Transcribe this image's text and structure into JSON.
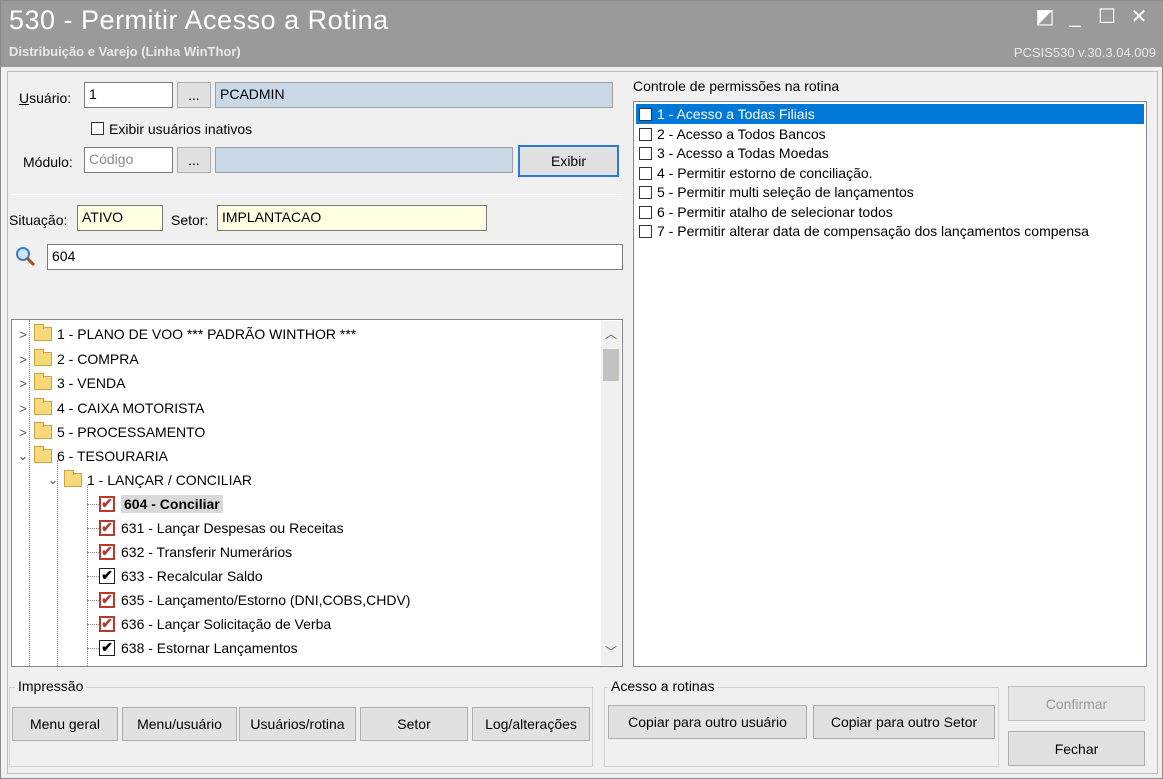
{
  "window": {
    "title": "530 - Permitir Acesso a Rotina",
    "subtitle": "Distribuição e Varejo (Linha WinThor)",
    "version": "PCSIS530  v.30.3.04.009",
    "controls": {
      "restore": "◩",
      "minimize": "_",
      "maximize": "☐",
      "close": "✕"
    }
  },
  "filters": {
    "usuario_label": "Usuário:",
    "usuario_code": "1",
    "usuario_browse": "...",
    "usuario_name": "PCADMIN",
    "inativos_label": "Exibir usuários inativos",
    "modulo_label": "Módulo:",
    "modulo_placeholder": "Código",
    "modulo_browse": "...",
    "exibir_button": "Exibir",
    "situacao_label": "Situação:",
    "situacao_value": "ATIVO",
    "setor_label": "Setor:",
    "setor_value": "IMPLANTACAO",
    "search_value": "604"
  },
  "tree": {
    "modules": [
      {
        "label": "1 - PLANO DE VOO   ***   PADRÃO WINTHOR  ***",
        "expanded": false
      },
      {
        "label": "2 - COMPRA",
        "expanded": false
      },
      {
        "label": "3 - VENDA",
        "expanded": false
      },
      {
        "label": "4 - CAIXA MOTORISTA",
        "expanded": false
      },
      {
        "label": "5 - PROCESSAMENTO",
        "expanded": false
      },
      {
        "label": "6 - TESOURARIA",
        "expanded": true
      }
    ],
    "subgroup": "1 - LANÇAR / CONCILIAR",
    "routines": [
      {
        "label": "604 - Conciliar",
        "checked": true,
        "style": "red",
        "selected": true
      },
      {
        "label": "631 - Lançar Despesas ou Receitas",
        "checked": true,
        "style": "red"
      },
      {
        "label": "632 - Transferir Numerários",
        "checked": true,
        "style": "red"
      },
      {
        "label": "633 - Recalcular Saldo",
        "checked": true,
        "style": "black"
      },
      {
        "label": "635 - Lançamento/Estorno (DNI,COBS,CHDV)",
        "checked": true,
        "style": "red"
      },
      {
        "label": "636 - Lançar Solicitação de Verba",
        "checked": true,
        "style": "red"
      },
      {
        "label": "638 - Estornar Lançamentos",
        "checked": true,
        "style": "black"
      }
    ]
  },
  "permissions": {
    "title": "Controle de permissões na rotina",
    "items": [
      {
        "label": "1 - Acesso a Todas Filiais",
        "selected": true
      },
      {
        "label": "2 - Acesso a Todos Bancos"
      },
      {
        "label": "3 - Acesso a Todas Moedas"
      },
      {
        "label": "4 - Permitir estorno de conciliação."
      },
      {
        "label": "5 - Permitir multi seleção de lançamentos"
      },
      {
        "label": "6 - Permitir atalho de selecionar todos"
      },
      {
        "label": "7 - Permitir alterar data de compensação dos lançamentos compensa"
      }
    ]
  },
  "impressao": {
    "title": "Impressão",
    "buttons": [
      "Menu geral",
      "Menu/usuário",
      "Usuários/rotina",
      "Setor",
      "Log/alterações"
    ]
  },
  "acesso": {
    "title": "Acesso a rotinas",
    "buttons": [
      "Copiar para outro usuário",
      "Copiar para outro Setor"
    ]
  },
  "actions": {
    "confirmar": "Confirmar",
    "fechar": "Fechar"
  },
  "colors": {
    "selection": "#0078d7",
    "titlebar": "#9a9a9a",
    "field_gray": "#c8d8e6",
    "field_yellow": "#ffffe1",
    "check_red": "#b83a2e"
  }
}
